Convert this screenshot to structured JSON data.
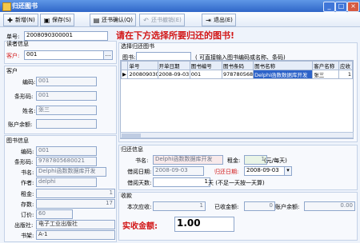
{
  "window": {
    "title": "归还图书",
    "minimize": "_",
    "maximize": "□",
    "close": "×"
  },
  "toolbar": {
    "new": "新增(N)",
    "save": "保存(S)",
    "return_confirm": "还书确认(Q)",
    "cancel_return": "还书撤销(E)",
    "exit": "退出(E)"
  },
  "order": {
    "label": "单号:",
    "value": "2008090300001"
  },
  "reader": {
    "group": "读者信息",
    "customer_label": "客户:",
    "customer_value": "001"
  },
  "customer": {
    "group": "客户",
    "id_label": "编码:",
    "id_value": "001",
    "barcode_label": "条形码:",
    "barcode_value": "001",
    "name_label": "姓名:",
    "name_value": "张三",
    "balance_label": "账户余额:",
    "balance_value": ""
  },
  "book": {
    "group": "图书信息",
    "id_label": "编码:",
    "id_value": "001",
    "barcode_label": "条形码:",
    "barcode_value": "9787805680021",
    "title_label": "书名:",
    "title_value": "Delphi函数数据库开发",
    "author_label": "作者:",
    "author_value": "delphi",
    "rent_label": "租金:",
    "rent_value": "1",
    "stock_label": "存数:",
    "stock_value": "17",
    "price_label": "订价:",
    "price_value": "60",
    "publisher_label": "出版社:",
    "publisher_value": "电子工业出版社",
    "shelf_label": "书架:",
    "shelf_value": "A-1"
  },
  "instruction": "请在下方选择所要归还的图书!",
  "selection": {
    "group": "选择归还图书",
    "book_label": "图书:",
    "hint": "( 可直接输入图书编码或名称、条码)",
    "columns": [
      "单号",
      "开单日期",
      "图书编号",
      "图书条码",
      "图书名称",
      "客户名称",
      "应收"
    ],
    "rows": [
      {
        "order": "2008090300001",
        "date": "2008-09-03",
        "book_id": "001",
        "barcode": "9787805680021",
        "title": "Delphi函数数据库开发",
        "customer": "张三",
        "due": "1"
      }
    ]
  },
  "return_info": {
    "group": "归还信息",
    "title_label": "书名:",
    "title_value": "Delphi函数数据库开发",
    "rent_label": "租金:",
    "rent_value": "1",
    "rent_unit": "(元/每天)",
    "borrow_date_label": "借阅日期:",
    "borrow_date_value": "2008-09-03",
    "return_date_label": "归还日期:",
    "return_date_value": "2008-09-03",
    "days_label": "借阅天数:",
    "days_value": "1",
    "days_unit": "天 (不足一天按一天算)"
  },
  "charge": {
    "group": "收款",
    "due_label": "本次应收:",
    "due_value": "1",
    "received_label": "已收金额:",
    "received_value": "0",
    "balance_label": "账户余额:",
    "balance_value": "0.00",
    "actual_label": "实收金额:",
    "actual_value": "1.00"
  }
}
